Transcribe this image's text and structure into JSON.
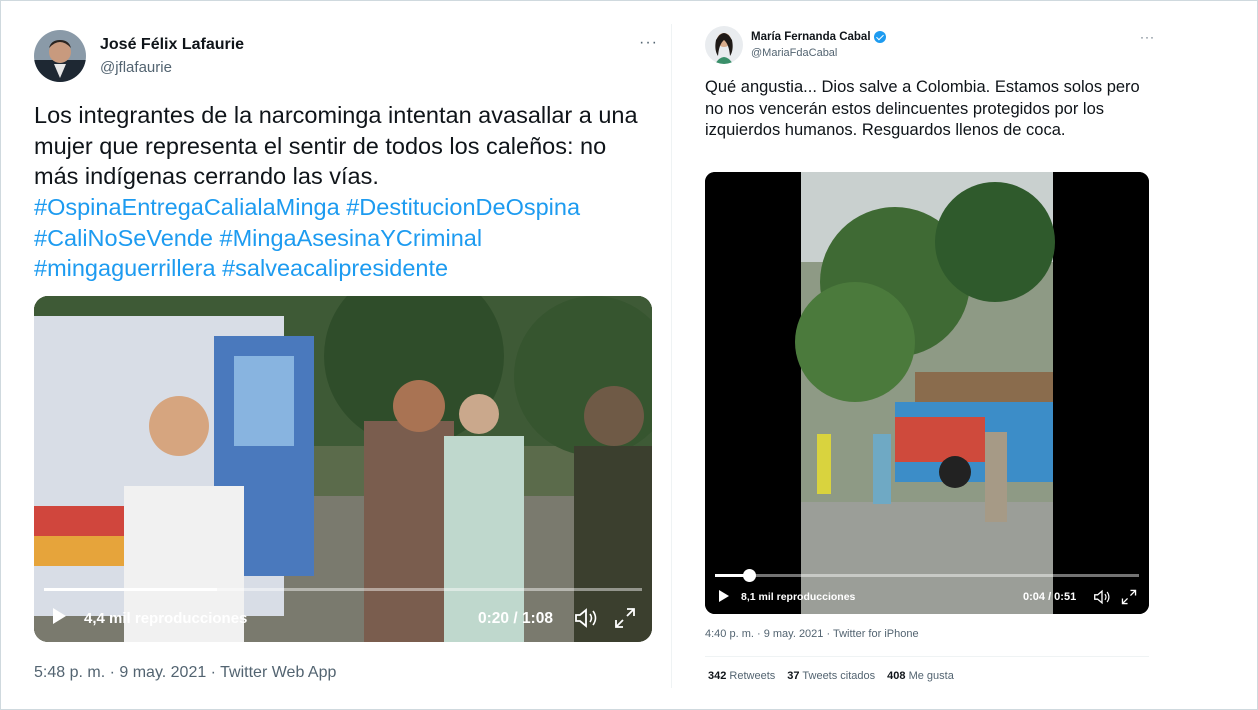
{
  "tweet1": {
    "name": "José Félix Lafaurie",
    "handle": "@jflafaurie",
    "more": "···",
    "text": "Los integrantes de la narcominga intentan avasallar a una mujer que representa el sentir de todos los caleños: no más indígenas cerrando las vías.",
    "hashtags": [
      "#OspinaEntregaCalialaMinga #DestitucionDeOspina",
      "#CaliNoSeVende #MingaAsesinaYCriminal",
      "#mingaguerrillera #salveacalipresidente"
    ],
    "video": {
      "views": "4,4 mil reproducciones",
      "time": "0:20 / 1:08",
      "progress": 0.29,
      "icons": [
        "play-icon",
        "volume-icon",
        "fullscreen-icon"
      ]
    },
    "meta": "5:48 p. m. · 9 may. 2021 · Twitter Web App"
  },
  "tweet2": {
    "name": "María Fernanda Cabal",
    "handle": "@MariaFdaCabal",
    "more": "···",
    "verified": true,
    "text": "Qué angustia... Dios salve a Colombia. Estamos solos pero no nos vencerán estos delincuentes protegidos por los izquierdos humanos. Resguardos llenos de coca.",
    "video": {
      "views": "8,1 mil reproducciones",
      "time": "0:04 / 0:51",
      "progress": 0.08,
      "icons": [
        "play-icon",
        "volume-icon",
        "fullscreen-icon"
      ]
    },
    "meta": "4:40 p. m. · 9 may. 2021 · Twitter for iPhone",
    "stats": {
      "retweets_count": "342",
      "retweets_label": "Retweets",
      "quotes_count": "37",
      "quotes_label": "Tweets citados",
      "likes_count": "408",
      "likes_label": "Me gusta"
    }
  },
  "colors": {
    "link": "#1d9bf0",
    "secondary_text": "#536471",
    "primary_text": "#0f1419"
  }
}
